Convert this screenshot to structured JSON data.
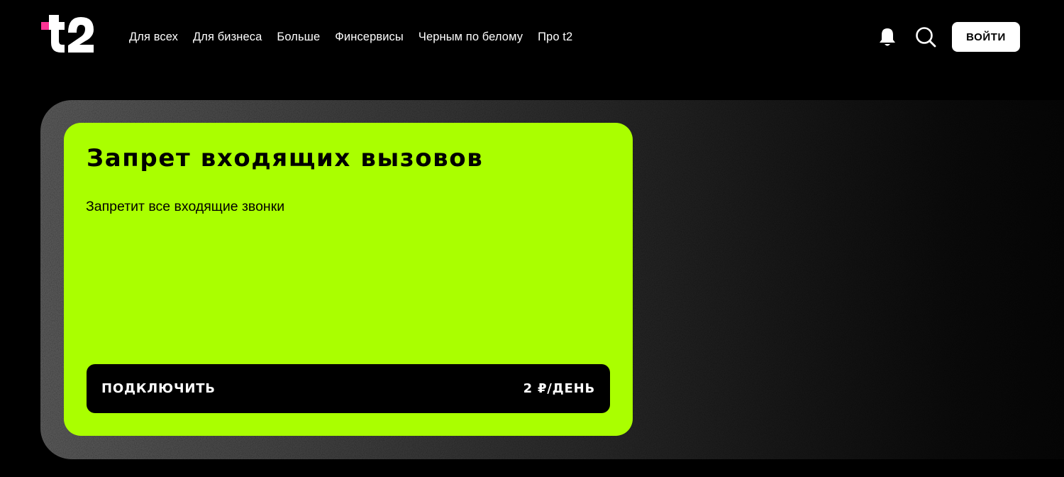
{
  "header": {
    "logo_text": "t2",
    "nav": [
      {
        "label": "Для всех"
      },
      {
        "label": "Для бизнеса"
      },
      {
        "label": "Больше"
      },
      {
        "label": "Финсервисы"
      },
      {
        "label": "Черным по белому"
      },
      {
        "label": "Про t2"
      }
    ],
    "icons": {
      "notifications": "bell-icon",
      "search": "search-icon"
    },
    "login_label": "ВОЙТИ"
  },
  "service_card": {
    "title": "Запрет входящих вызовов",
    "description": "Запретит все входящие звонки",
    "connect_label": "ПОДКЛЮЧИТЬ",
    "price": "2 ₽/ДЕНЬ"
  },
  "colors": {
    "background": "#000000",
    "accent": "#aaff00",
    "logo_dot": "#ff3495",
    "button_bg": "#ffffff"
  }
}
